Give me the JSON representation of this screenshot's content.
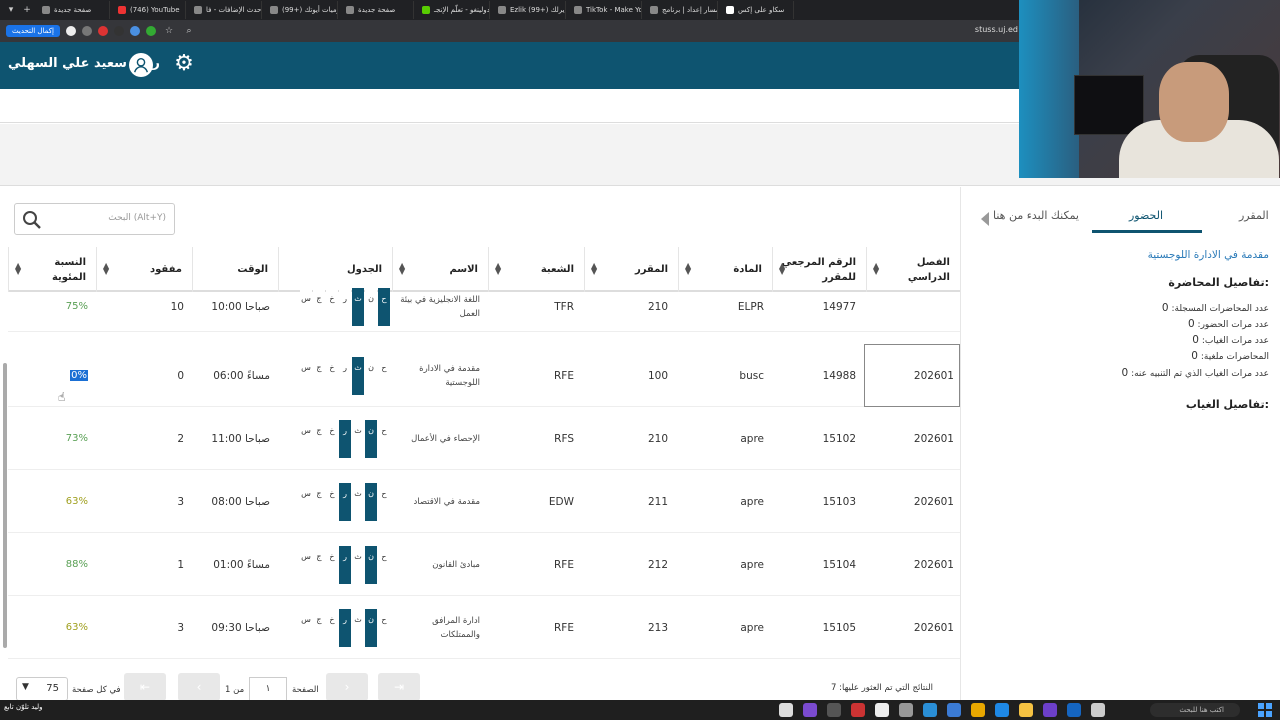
{
  "browser": {
    "tabs": [
      {
        "title": "سكاو على إكس"
      },
      {
        "title": "مسار إعداد | برنامج"
      },
      {
        "title": "TikTok - Make Your"
      },
      {
        "title": "Ezlik (99+) إيرلك"
      },
      {
        "title": "دولينغو - تعلّم الإنجـ"
      },
      {
        "title": "صفحة جديدة"
      },
      {
        "title": "(99+) يوميات أيوتك"
      },
      {
        "title": "أحدث الإضافات - فا"
      },
      {
        "title": "(746) YouTube"
      },
      {
        "title": "صفحة جديدة"
      }
    ],
    "relaunch_label": "إكمال التحديث",
    "url": "stuss.uj.ed"
  },
  "header": {
    "user_name": "ريان سعيد علي السهلي"
  },
  "search": {
    "placeholder": "البحث (Alt+Y)"
  },
  "table": {
    "columns": [
      {
        "key": "term",
        "label": "الفصل\nالدراسي"
      },
      {
        "key": "ref",
        "label": "الرقم المرجعي\nللمقرر"
      },
      {
        "key": "subject",
        "label": "المادة"
      },
      {
        "key": "course",
        "label": "المقرر"
      },
      {
        "key": "section",
        "label": "الشعبة"
      },
      {
        "key": "name",
        "label": "الاسم"
      },
      {
        "key": "schedule",
        "label": "الجدول"
      },
      {
        "key": "time",
        "label": "الوقت"
      },
      {
        "key": "missed",
        "label": "مفقود"
      },
      {
        "key": "percent",
        "label": "النسبة\nالمئوية"
      }
    ],
    "day_letters": [
      "ح",
      "ن",
      "ث",
      "ر",
      "خ",
      "ج",
      "س"
    ],
    "rows": [
      {
        "term": "",
        "ref": "14977",
        "subject": "ELPR",
        "course": "210",
        "section": "TFR",
        "name": "اللغة الانجليزية في بيئة العمل",
        "days_on": [
          0,
          2
        ],
        "time": "10:00 صباحا",
        "missed": "10",
        "percent": "75%",
        "pct_color": "g"
      },
      {
        "term": "202601",
        "ref": "14988",
        "subject": "busc",
        "course": "100",
        "section": "RFE",
        "name": "مقدمة في الادارة اللوجستية",
        "days_on": [
          2
        ],
        "time": "06:00 مساءً",
        "missed": "0",
        "percent": "0%",
        "pct_color": "sel"
      },
      {
        "term": "202601",
        "ref": "15102",
        "subject": "apre",
        "course": "210",
        "section": "RFS",
        "name": "الإحصاء في الأعمال",
        "days_on": [
          1,
          3
        ],
        "time": "11:00 صباحا",
        "missed": "2",
        "percent": "73%",
        "pct_color": "g"
      },
      {
        "term": "202601",
        "ref": "15103",
        "subject": "apre",
        "course": "211",
        "section": "EDW",
        "name": "مقدمة في الاقتصاد",
        "days_on": [
          1,
          3
        ],
        "time": "08:00 صباحا",
        "missed": "3",
        "percent": "63%",
        "pct_color": "o"
      },
      {
        "term": "202601",
        "ref": "15104",
        "subject": "apre",
        "course": "212",
        "section": "RFE",
        "name": "مبادئ القانون",
        "days_on": [
          1,
          3
        ],
        "time": "01:00 مساءً",
        "missed": "1",
        "percent": "88%",
        "pct_color": "g"
      },
      {
        "term": "202601",
        "ref": "15105",
        "subject": "apre",
        "course": "213",
        "section": "RFE",
        "name": "ادارة المرافق والممتلكات",
        "days_on": [
          1,
          3
        ],
        "time": "09:30 صباحا",
        "missed": "3",
        "percent": "63%",
        "pct_color": "o"
      }
    ]
  },
  "pagination": {
    "per_page_value": "75",
    "per_page_label": "في كل صفحة",
    "page_label": "الصفحة",
    "page_value": "١",
    "of_label": "من 1",
    "results_label": "النتائج التي تم العثور عليها: 7"
  },
  "panel": {
    "tabs": [
      "المقرر",
      "الحضور",
      "يمكنك البدء من هنا"
    ],
    "active_tab": "الحضور",
    "course_title": "مقدمة في الادارة اللوجستية",
    "lecture_details_heading": "تفاصيل المحاضرة:",
    "stats": [
      {
        "label": "عدد المحاضرات المسجلة:",
        "value": "0"
      },
      {
        "label": "عدد مرات الحضور:",
        "value": "0"
      },
      {
        "label": "عدد مرات الغياب:",
        "value": "0"
      },
      {
        "label": "المحاضرات ملغية:",
        "value": "0"
      },
      {
        "label": "عدد مرات الغياب الذي تم التنبيه عنه:",
        "value": "0"
      }
    ],
    "absence_details_heading": "تفاصيل الغياب:"
  },
  "taskbar": {
    "left_text": "وليد تلوّن تابع",
    "search_placeholder": "اكتب هنا للبحث"
  },
  "colors": {
    "primary": "#0e5470",
    "good": "#5aa055",
    "warn": "#a0a020",
    "selection": "#1a6fd4",
    "link": "#2a7ab8"
  }
}
